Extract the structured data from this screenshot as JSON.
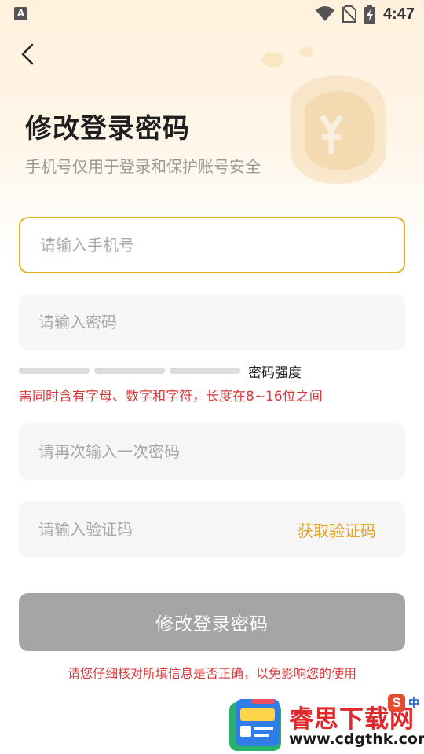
{
  "status_bar": {
    "left_badge": "A",
    "time": "4:47",
    "icons": [
      "wifi-icon",
      "no-sim-icon",
      "battery-charging-icon"
    ]
  },
  "header": {
    "back_icon": "chevron-left-icon",
    "title": "修改登录密码",
    "subtitle": "手机号仅用于登录和保护账号安全"
  },
  "form": {
    "phone_placeholder": "请输入手机号",
    "password_placeholder": "请输入密码",
    "password_strength_label": "密码强度",
    "password_strength_level": 0,
    "password_rule": "需同时含有字母、数字和字符，长度在8~16位之间",
    "confirm_placeholder": "请再次输入一次密码",
    "code_placeholder": "请输入验证码",
    "get_code_label": "获取验证码",
    "submit_label": "修改登录密码",
    "note": "请您仔细核对所填信息是否正确，以免影响您的使用"
  },
  "colors": {
    "accent": "#e3a422",
    "warning": "#d93a3a",
    "button_disabled": "#a5a5a5",
    "field_bg": "#f6f6f6"
  },
  "watermark": {
    "name": "睿思下载网",
    "url": "www.cdgthk.com",
    "ime_badge": "S",
    "ime_lang": "中"
  }
}
